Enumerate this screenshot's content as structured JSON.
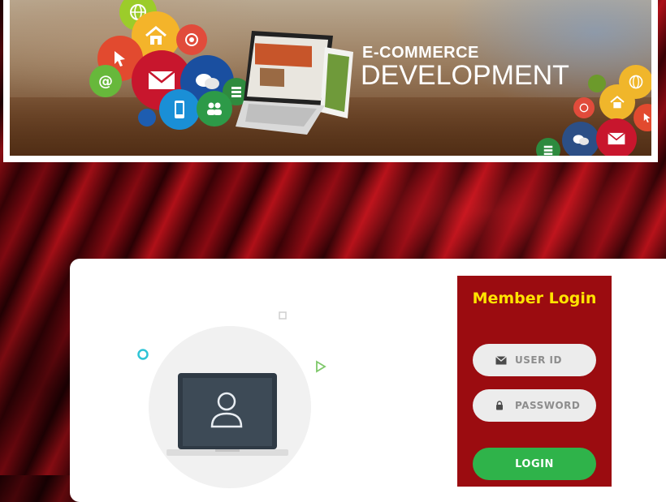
{
  "banner": {
    "title": "E-COMMERCE",
    "subtitle": "DEVELOPMENT",
    "icons": [
      "globe-icon",
      "home-icon",
      "chrome-icon",
      "cursor-icon",
      "mail-icon",
      "chat-icon",
      "at-icon",
      "phone-icon",
      "users-icon",
      "server-icon"
    ]
  },
  "login": {
    "title": "Member Login",
    "user_placeholder": "USER ID",
    "password_placeholder": "PASSWORD",
    "button_label": "LOGIN",
    "accent_color": "#9b0c10",
    "title_color": "#ffe400",
    "button_color": "#2fb34a"
  }
}
